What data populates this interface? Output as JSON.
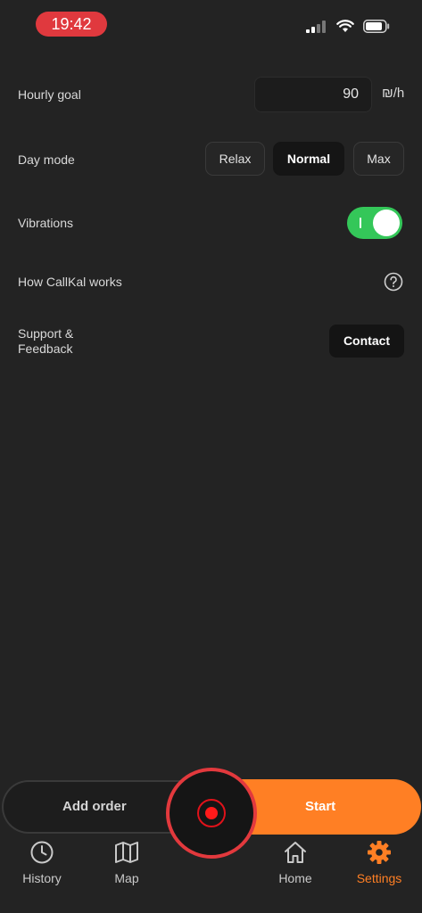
{
  "status_bar": {
    "time": "19:42",
    "time_pill_color": "#e0393e"
  },
  "settings": {
    "hourly_goal": {
      "label": "Hourly goal",
      "value": "90",
      "unit": "₪/h"
    },
    "day_mode": {
      "label": "Day mode",
      "options": [
        "Relax",
        "Normal",
        "Max"
      ],
      "selected": "Normal"
    },
    "vibrations": {
      "label": "Vibrations",
      "enabled": true,
      "toggle_color": "#34c759"
    },
    "how_it_works": {
      "label": "How CallKal works"
    },
    "support": {
      "label_line1": "Support &",
      "label_line2": "Feedback",
      "button": "Contact"
    }
  },
  "action_bar": {
    "add_order": "Add order",
    "start": "Start",
    "start_color": "#ff7f24",
    "record_color": "#e2393d"
  },
  "tabs": [
    {
      "label": "History",
      "icon": "clock-icon",
      "active": false
    },
    {
      "label": "Map",
      "icon": "map-icon",
      "active": false
    },
    {
      "label": "Home",
      "icon": "home-icon",
      "active": false
    },
    {
      "label": "Settings",
      "icon": "gear-icon",
      "active": true
    }
  ],
  "accent_color": "#ff7f24"
}
